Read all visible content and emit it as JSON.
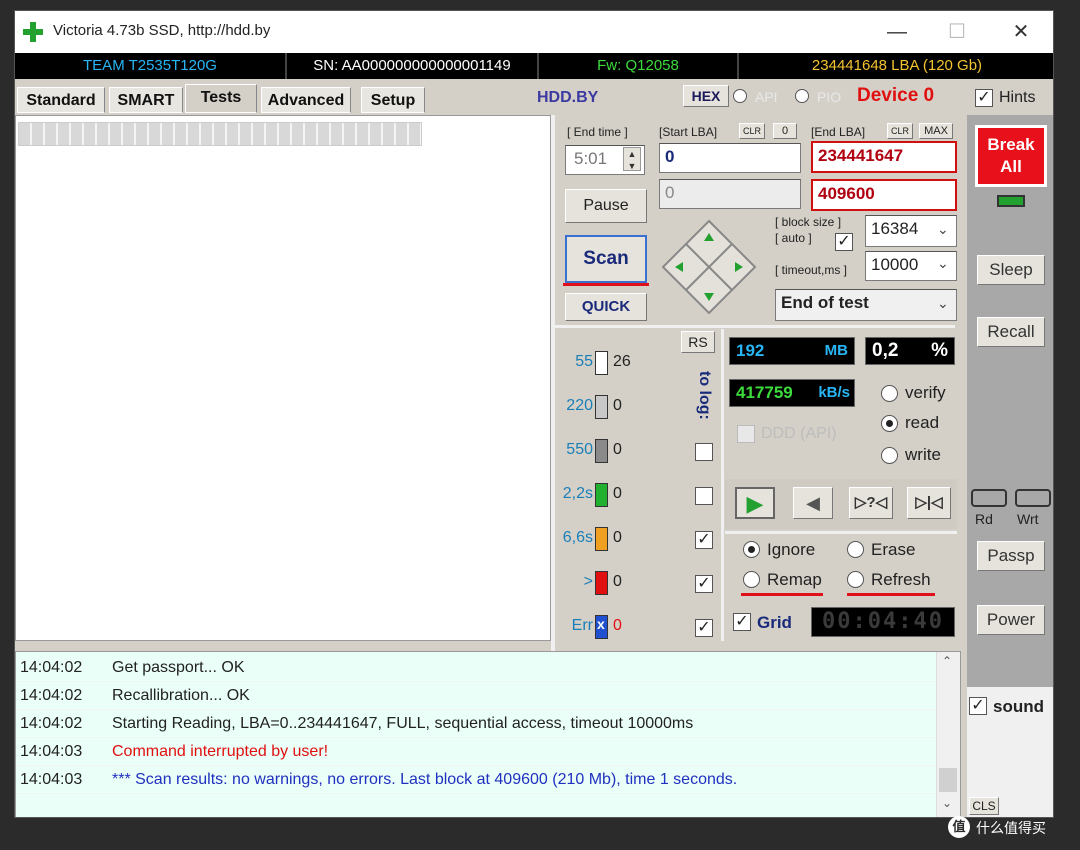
{
  "window": {
    "title": "Victoria 4.73b SSD, http://hdd.by",
    "minimize": "—",
    "maximize": "☐",
    "close": "✕"
  },
  "infobar": {
    "model": "TEAM T2535T120G",
    "serial": "SN: AA000000000000001149",
    "firmware": "Fw: Q12058",
    "capacity": "234441648 LBA (120 Gb)"
  },
  "tabs": {
    "standard": "Standard",
    "smart": "SMART",
    "tests": "Tests",
    "advanced": "Advanced",
    "setup": "Setup"
  },
  "header": {
    "hddby": "HDD.BY",
    "hex": "HEX",
    "api": "API",
    "pio": "PIO",
    "device": "Device 0",
    "hints": "Hints",
    "hints_check": "✓"
  },
  "controls": {
    "end_time_label": "[ End time ]",
    "end_time_value": "5:01",
    "start_lba_label": "[Start LBA]",
    "clr": "CLR",
    "zero_badge": "0",
    "start_lba_value": "0",
    "second_field_value": "0",
    "end_lba_label": "[End LBA]",
    "max": "MAX",
    "end_lba_value": "234441647",
    "end_lba_second": "409600",
    "pause": "Pause",
    "scan": "Scan",
    "quick": "QUICK",
    "block_size_label": "[ block size ]",
    "auto_label": "[ auto ]",
    "auto_check": "✓",
    "block_size_value": "16384",
    "timeout_label": "[ timeout,ms ]",
    "timeout_value": "10000",
    "end_of_test": "End of test"
  },
  "stats": {
    "rs": "RS",
    "to_log": "to log:",
    "rows": [
      {
        "label": "55",
        "count": "26",
        "color": "#ffffff",
        "check": ""
      },
      {
        "label": "220",
        "count": "0",
        "color": "#c8c8c8",
        "check": ""
      },
      {
        "label": "550",
        "count": "0",
        "color": "#8a8a8a",
        "check": ""
      },
      {
        "label": "2,2s",
        "count": "0",
        "color": "#22b030",
        "check": ""
      },
      {
        "label": "6,6s",
        "count": "0",
        "color": "#f0a020",
        "check": "✓"
      },
      {
        "label": ">",
        "count": "0",
        "color": "#e01010",
        "check": "✓"
      },
      {
        "label": "Err",
        "count": "0",
        "color": "#2050d0",
        "check": "✓"
      }
    ],
    "err_mark": "x",
    "mb_value": "192",
    "mb_unit": "MB",
    "percent_value": "0,2",
    "percent_unit": "%",
    "speed_value": "417759",
    "speed_unit": "kB/s",
    "verify": "verify",
    "read": "read",
    "write": "write",
    "ddd": "DDD (API)"
  },
  "playback": {
    "play": "▶",
    "back": "◀",
    "skip": "▷?◁",
    "end": "▷|◁"
  },
  "actions": {
    "ignore": "Ignore",
    "erase": "Erase",
    "remap": "Remap",
    "refresh": "Refresh",
    "grid": "Grid",
    "grid_check": "✓",
    "timer": "00:04:40"
  },
  "side": {
    "break_all": "Break All",
    "sleep": "Sleep",
    "recall": "Recall",
    "rd": "Rd",
    "wrt": "Wrt",
    "passp": "Passp",
    "power": "Power",
    "sound": "sound",
    "sound_check": "✓",
    "cls": "CLS"
  },
  "log": [
    {
      "time": "14:04:02",
      "message": "Get passport... OK",
      "color": "#222222"
    },
    {
      "time": "14:04:02",
      "message": "Recallibration... OK",
      "color": "#222222"
    },
    {
      "time": "14:04:02",
      "message": "Starting Reading, LBA=0..234441647, FULL, sequential access, timeout 10000ms",
      "color": "#222222"
    },
    {
      "time": "14:04:03",
      "message": "Command interrupted by user!",
      "color": "#e01010"
    },
    {
      "time": "14:04:03",
      "message": "*** Scan results: no warnings, no errors. Last block at 409600 (210 Mb), time 1 seconds.",
      "color": "#2030c0"
    }
  ],
  "watermark": "值 什么值得买",
  "colors": {
    "accent_red": "#e0101a",
    "lcd_blue": "#29b6f6",
    "lcd_green": "#3ddc3d"
  }
}
